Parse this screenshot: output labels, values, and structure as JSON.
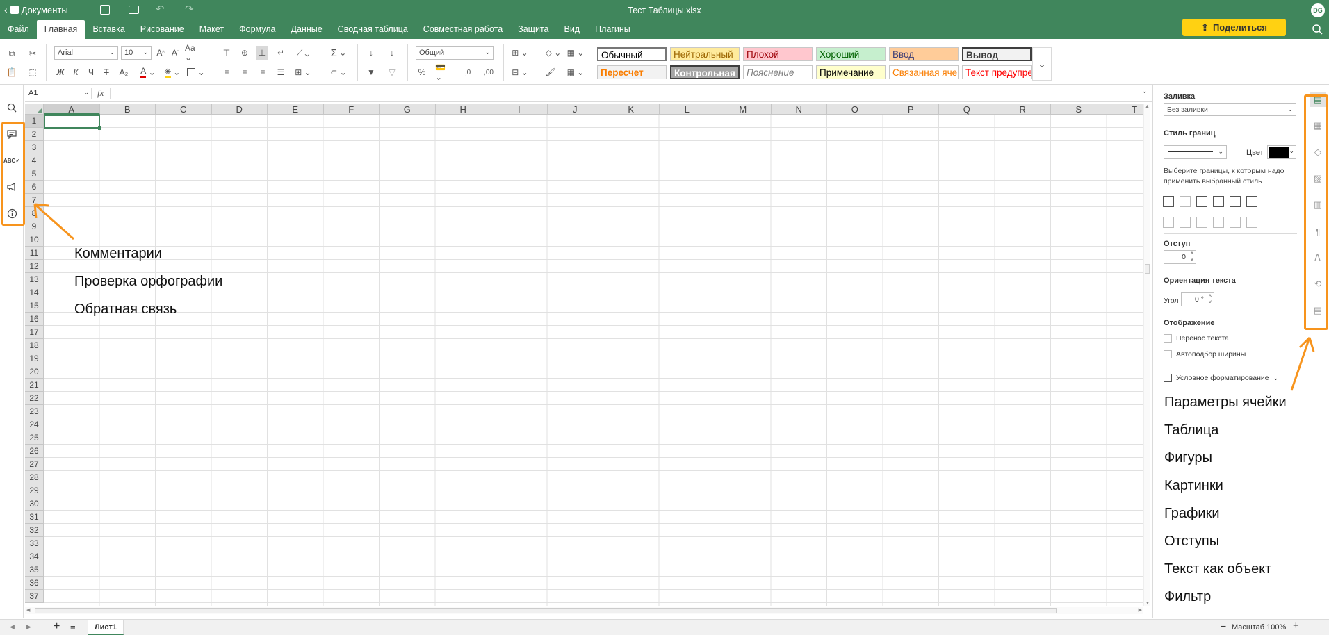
{
  "app": {
    "back_label": "Документы",
    "file_title": "Тест Таблицы.xlsx",
    "avatar_initials": "DG"
  },
  "menu": {
    "tabs": [
      "Файл",
      "Главная",
      "Вставка",
      "Рисование",
      "Макет",
      "Формула",
      "Данные",
      "Сводная таблица",
      "Совместная работа",
      "Защита",
      "Вид",
      "Плагины"
    ],
    "active_tab": "Главная",
    "share_label": "Поделиться"
  },
  "ribbon": {
    "font_name": "Arial",
    "font_size": "10",
    "number_format": "Общий",
    "bold_label": "Ж",
    "italic_label": "К",
    "underline_label": "Ч",
    "strike_label": "Т",
    "subscript_label": "A₂",
    "sum_label": "Σ",
    "percent_label": "%",
    "dec_dec_label": ",0",
    "dec_inc_label": ",00",
    "cell_styles": [
      {
        "label": "Обычный",
        "color": "#000000",
        "bg": "#ffffff",
        "bold": false
      },
      {
        "label": "Нейтральный",
        "color": "#9c6500",
        "bg": "#ffeb9c",
        "bold": false
      },
      {
        "label": "Плохой",
        "color": "#9c0006",
        "bg": "#ffc7ce",
        "bold": false
      },
      {
        "label": "Хороший",
        "color": "#006100",
        "bg": "#c6efce",
        "bold": false
      },
      {
        "label": "Ввод",
        "color": "#3f3f76",
        "bg": "#ffcc99",
        "bold": false
      },
      {
        "label": "Вывод",
        "color": "#3f3f3f",
        "bg": "#f2f2f2",
        "bold": true
      },
      {
        "label": "Пересчет",
        "color": "#fa7d00",
        "bg": "#f2f2f2",
        "bold": true
      },
      {
        "label": "Контрольная",
        "color": "#ffffff",
        "bg": "#a5a5a5",
        "bold": true
      },
      {
        "label": "Пояснение",
        "color": "#7f7f7f",
        "bg": "#ffffff",
        "bold": false
      },
      {
        "label": "Примечание",
        "color": "#000000",
        "bg": "#ffffcc",
        "bold": false
      },
      {
        "label": "Связанная ячейка",
        "color": "#fa7d00",
        "bg": "#ffffff",
        "bold": false
      },
      {
        "label": "Текст предупреждения",
        "color": "#ff0000",
        "bg": "#ffffff",
        "bold": false
      }
    ]
  },
  "formula_bar": {
    "cell_ref": "A1",
    "fx_label": "fx",
    "value": ""
  },
  "sheet": {
    "columns": [
      "A",
      "B",
      "C",
      "D",
      "E",
      "F",
      "G",
      "H",
      "I",
      "J",
      "K",
      "L",
      "M",
      "N",
      "O",
      "P",
      "Q",
      "R",
      "S",
      "T"
    ],
    "rows": [
      "1",
      "2",
      "3",
      "4",
      "5",
      "6",
      "7",
      "8",
      "9",
      "10",
      "11",
      "12",
      "13",
      "14",
      "15",
      "16",
      "17",
      "18",
      "19",
      "20",
      "21",
      "22",
      "23",
      "24",
      "25",
      "26",
      "27",
      "28",
      "29",
      "30",
      "31",
      "32",
      "33",
      "34",
      "35",
      "36",
      "37"
    ],
    "active_cell": "A1"
  },
  "right_panel": {
    "fill_label": "Заливка",
    "fill_value": "Без заливки",
    "border_style_label": "Стиль границ",
    "color_label": "Цвет",
    "border_hint": "Выберите границы, к которым надо применить выбранный стиль",
    "indent_label": "Отступ",
    "indent_value": "0",
    "orientation_label": "Ориентация текста",
    "angle_label": "Угол",
    "angle_value": "0 °",
    "display_label": "Отображение",
    "wrap_label": "Перенос текста",
    "autofit_label": "Автоподбор ширины",
    "conditional_label": "Условное форматирование"
  },
  "annotations": {
    "left": [
      "Комментарии",
      "Проверка орфографии",
      "Обратная связь"
    ],
    "right": [
      "Параметры ячейки",
      "Таблица",
      "Фигуры",
      "Картинки",
      "Графики",
      "Отступы",
      "Текст как объект",
      "Фильтр"
    ]
  },
  "bottom": {
    "sheet_tab": "Лист1",
    "zoom_label": "Масштаб 100%"
  },
  "colors": {
    "brand": "#40865c",
    "accent": "#f7941d",
    "share": "#ffd112",
    "active_tab_border": "#40865c"
  }
}
